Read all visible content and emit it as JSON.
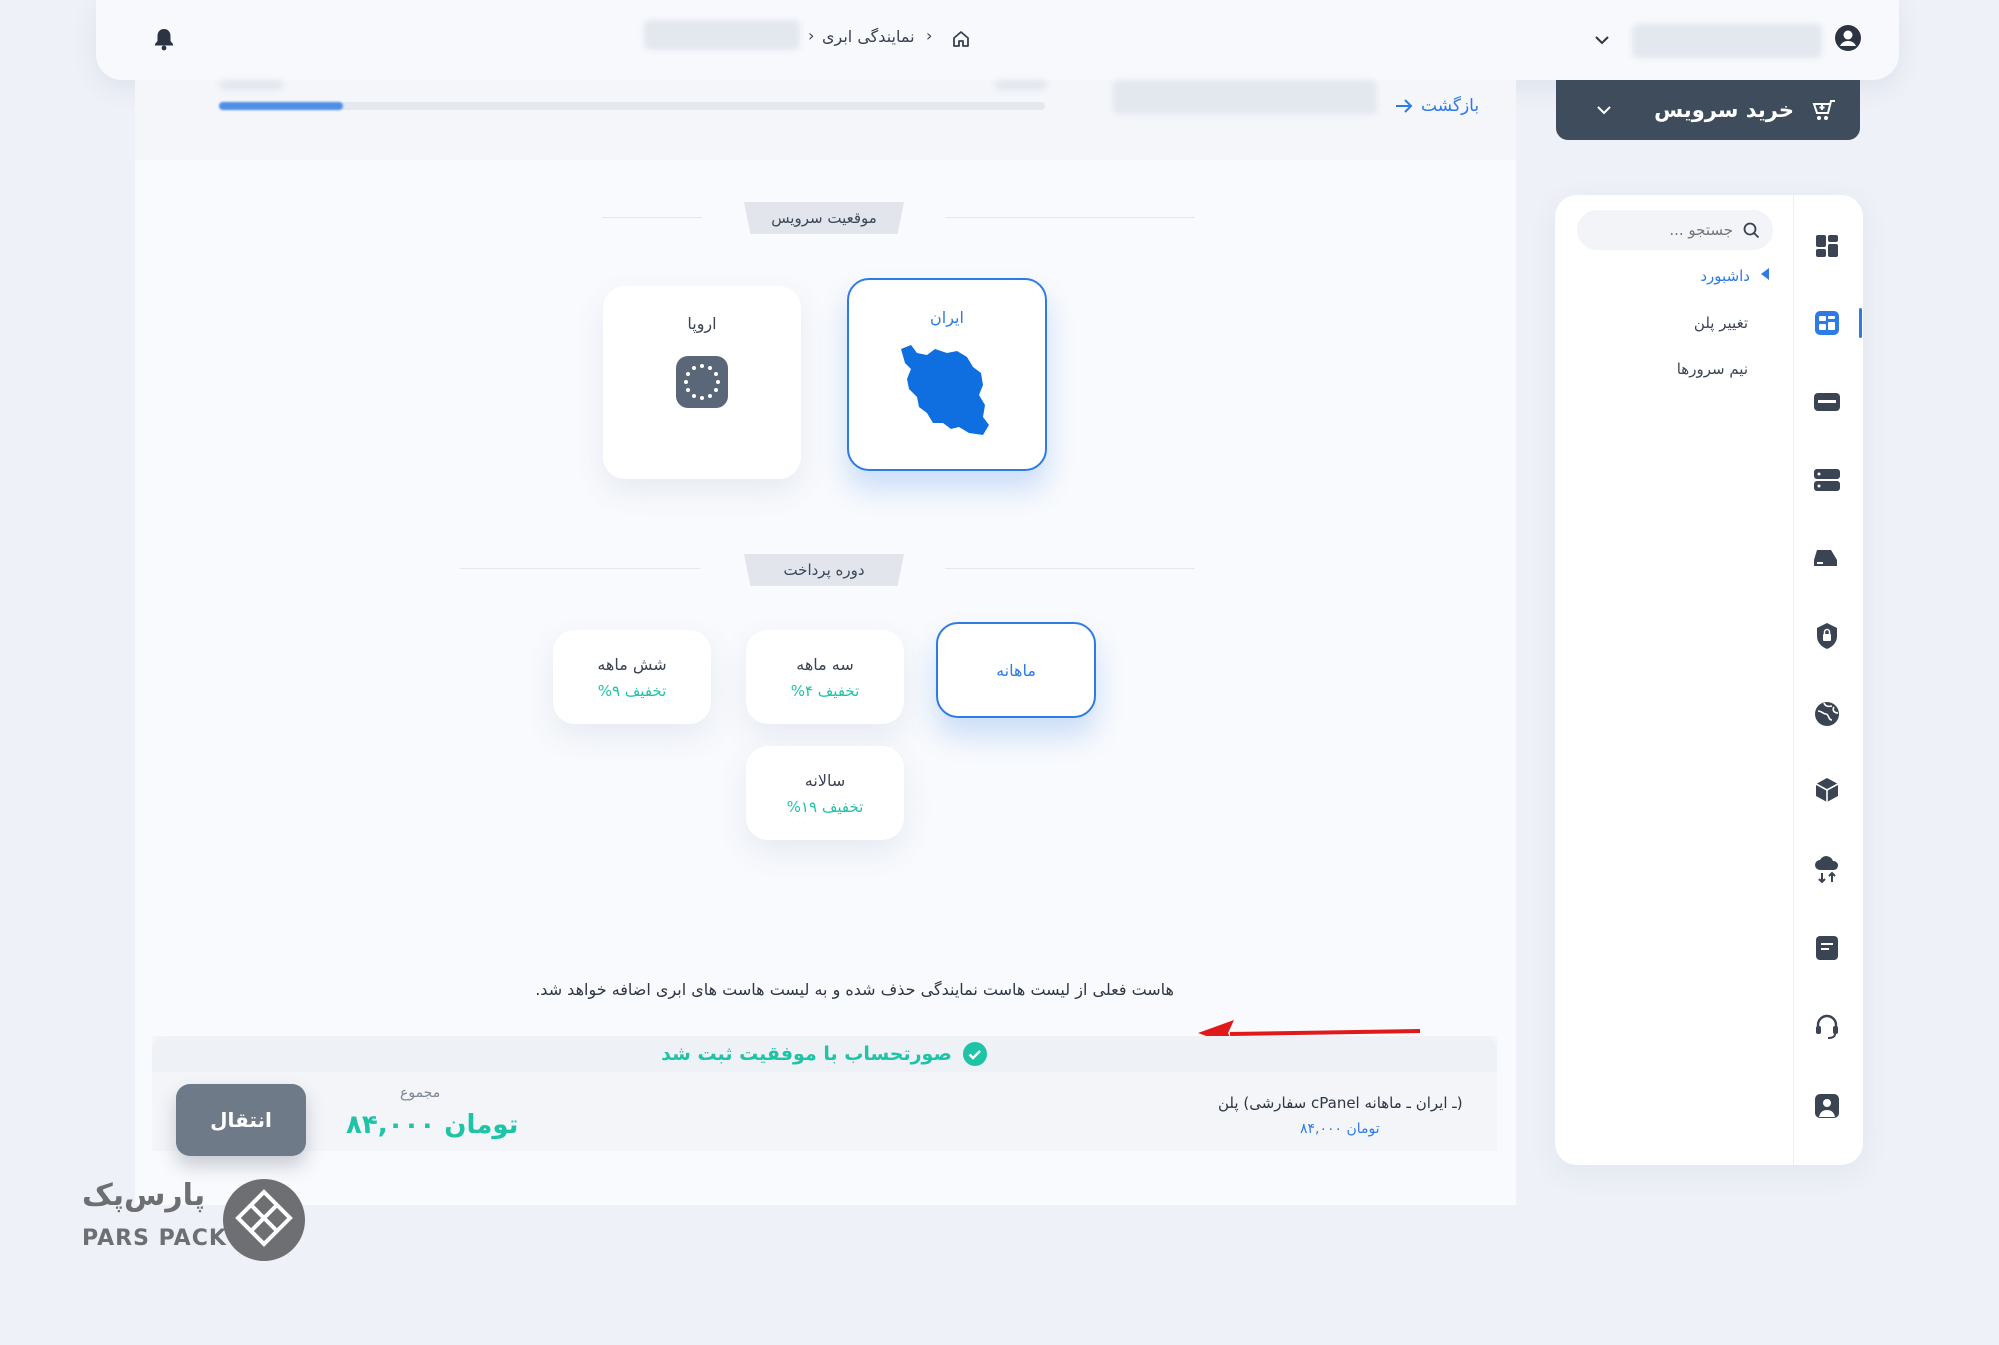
{
  "header": {
    "breadcrumb_current": "نمایندگی ابری",
    "breadcrumb_sep": "›",
    "blurred_user_placeholder": "",
    "icons": [
      "bell-icon",
      "home-icon",
      "user-icon",
      "chevron-down-icon"
    ]
  },
  "top_panel": {
    "back_label": "بازگشت"
  },
  "buy_service": {
    "label": "خرید سرویس"
  },
  "sidebar": {
    "search_placeholder": "جستجو ...",
    "items": [
      {
        "label": "داشبورد",
        "active": true
      },
      {
        "label": "تغییر پلن",
        "active": false
      },
      {
        "label": "نیم سرورها",
        "active": false
      }
    ],
    "rail_icons": [
      "dashboard-icon",
      "hosting-icon",
      "server-icon",
      "dedicated-server-icon",
      "vps-icon",
      "ssl-lock-icon",
      "domain-globe-icon",
      "package-icon",
      "cloud-transfer-icon",
      "invoice-icon",
      "support-headset-icon",
      "account-icon"
    ]
  },
  "location_section": {
    "heading": "موقعیت سرویس",
    "options": [
      {
        "label": "ایران",
        "selected": true
      },
      {
        "label": "اروپا",
        "selected": false
      }
    ]
  },
  "payment_section": {
    "heading": "دوره پرداخت",
    "options": [
      {
        "label": "ماهانه",
        "discount": "",
        "selected": true
      },
      {
        "label": "سه ماهه",
        "discount": "%۴ تخفیف",
        "selected": false
      },
      {
        "label": "شش ماهه",
        "discount": "%۹ تخفیف",
        "selected": false
      },
      {
        "label": "سالانه",
        "discount": "%۱۹ تخفیف",
        "selected": false
      }
    ]
  },
  "notice": "هاست فعلی از لیست هاست نمایندگی حذف شده و به لیست هاست های ابری اضافه خواهد شد.",
  "toast": "صورتحساب با موفقیت ثبت شد",
  "summary": {
    "plan_label": "پلن (سفارشی cPanel ـ ایران ـ ماهانه)",
    "plan_price": "۸۴,۰۰۰ تومان",
    "total_label": "مجموع",
    "total_value": "۸۴,۰۰۰ تومان",
    "transfer_button": "انتقال"
  },
  "brand": {
    "name_fa": "پارس‌پک",
    "name_en": "PARS PACK"
  },
  "colors": {
    "accent": "#2f7be5",
    "success": "#1fc3a6",
    "dark_button": "#3f4c5c",
    "annotation_arrow": "#e0191b"
  }
}
